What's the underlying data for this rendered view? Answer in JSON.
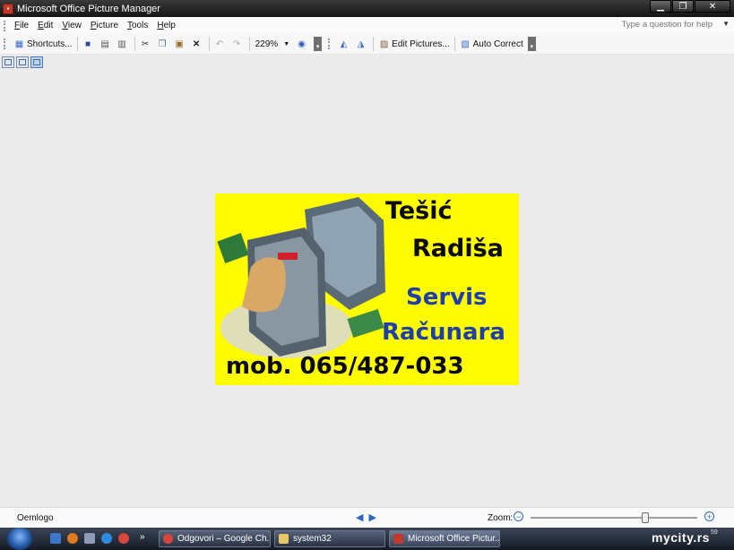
{
  "window": {
    "title": "Microsoft Office Picture Manager",
    "controls": [
      "▁",
      "❐",
      "✕"
    ]
  },
  "menu": {
    "items": [
      {
        "underline": "F",
        "rest": "ile"
      },
      {
        "underline": "E",
        "rest": "dit"
      },
      {
        "underline": "V",
        "rest": "iew"
      },
      {
        "underline": "P",
        "rest": "icture"
      },
      {
        "underline": "T",
        "rest": "ools"
      },
      {
        "underline": "H",
        "rest": "elp"
      }
    ],
    "help_placeholder": "Type a question for help"
  },
  "toolbar": {
    "shortcuts_label": "Shortcuts...",
    "zoom_value": "229%",
    "edit_pictures_label": "Edit Pictures...",
    "auto_correct_label": "Auto Correct"
  },
  "image": {
    "line1": "Tešić",
    "line2": "Radiša",
    "line3": "Servis",
    "line4": "Računara",
    "line5": "mob. 065/487-033"
  },
  "status": {
    "filename": "Oemlogo",
    "zoom_label": "Zoom:",
    "zoom_level": 0.69
  },
  "taskbar": {
    "tasks": [
      {
        "label": "Odgovori – Google Ch..."
      },
      {
        "label": "system32"
      },
      {
        "label": "Microsoft Office Pictur..."
      }
    ],
    "tray_text": "mycity.rs",
    "clock": "59"
  },
  "colors": {
    "image_background": "#fffb00",
    "service_text": "#1e3fa8",
    "nav_arrow": "#2b64c7"
  }
}
